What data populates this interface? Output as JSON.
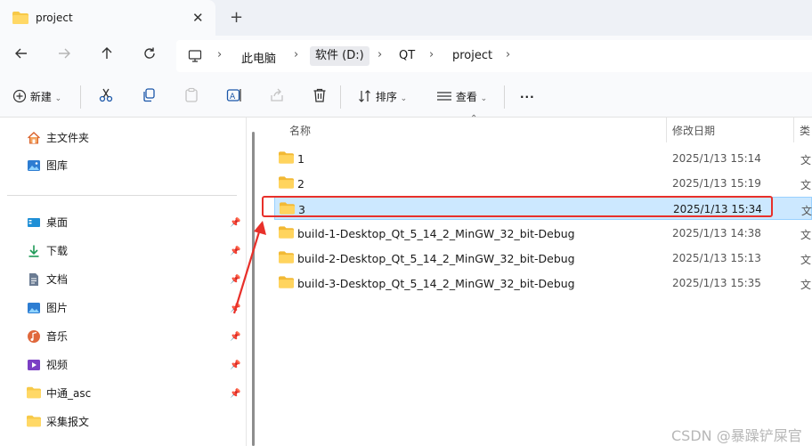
{
  "window": {
    "tab_title": "project",
    "close_glyph": "✕",
    "new_tab_glyph": "+"
  },
  "nav": {
    "back_icon": "arrow-left-icon",
    "forward_icon": "arrow-right-icon",
    "up_icon": "arrow-up-icon",
    "refresh_icon": "refresh-icon",
    "breadcrumbs": [
      "此电脑",
      "软件 (D:)",
      "QT",
      "project"
    ],
    "active_crumb": "软件 (D:)"
  },
  "toolbar": {
    "new_label": "新建",
    "sort_label": "排序",
    "view_label": "查看",
    "more_glyph": "···"
  },
  "sidebar": {
    "top_items": [
      {
        "label": "主文件夹",
        "icon": "home-icon"
      },
      {
        "label": "图库",
        "icon": "gallery-icon"
      }
    ],
    "pinned_items": [
      {
        "label": "桌面",
        "icon": "desktop-icon",
        "pinned": true
      },
      {
        "label": "下载",
        "icon": "download-icon",
        "pinned": true
      },
      {
        "label": "文档",
        "icon": "document-icon",
        "pinned": true
      },
      {
        "label": "图片",
        "icon": "pictures-icon",
        "pinned": true
      },
      {
        "label": "音乐",
        "icon": "music-icon",
        "pinned": true
      },
      {
        "label": "视频",
        "icon": "video-icon",
        "pinned": true
      },
      {
        "label": "中通_asc",
        "icon": "folder-icon",
        "pinned": true
      },
      {
        "label": "采集报文",
        "icon": "folder-icon",
        "pinned": false
      }
    ]
  },
  "columns": {
    "name": "名称",
    "modified": "修改日期",
    "type": "类"
  },
  "files": [
    {
      "name": "1",
      "modified": "2025/1/13 15:14",
      "type": "文",
      "selected": false
    },
    {
      "name": "2",
      "modified": "2025/1/13 15:19",
      "type": "文",
      "selected": false
    },
    {
      "name": "3",
      "modified": "2025/1/13 15:34",
      "type": "文",
      "selected": true
    },
    {
      "name": "build-1-Desktop_Qt_5_14_2_MinGW_32_bit-Debug",
      "modified": "2025/1/13 14:38",
      "type": "文",
      "selected": false
    },
    {
      "name": "build-2-Desktop_Qt_5_14_2_MinGW_32_bit-Debug",
      "modified": "2025/1/13 15:13",
      "type": "文",
      "selected": false
    },
    {
      "name": "build-3-Desktop_Qt_5_14_2_MinGW_32_bit-Debug",
      "modified": "2025/1/13 15:35",
      "type": "文",
      "selected": false
    }
  ],
  "annotation": {
    "highlight_color": "#e8302a",
    "target": "3"
  },
  "watermark": "CSDN @暴躁铲屎官",
  "colors": {
    "folder": "#f7c948",
    "selection": "#cce8ff",
    "accent": "#0067c0"
  }
}
